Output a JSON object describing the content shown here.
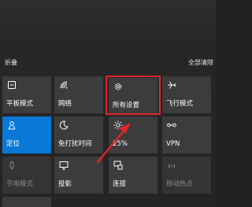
{
  "header": {
    "collapse_label": "折叠",
    "clear_all_label": "全部清除"
  },
  "tiles": [
    {
      "label": "平板模式",
      "icon": "tablet-mode-icon",
      "state": "off"
    },
    {
      "label": "网络",
      "icon": "network-icon",
      "state": "off"
    },
    {
      "label": "所有设置",
      "icon": "settings-gear-icon",
      "state": "off"
    },
    {
      "label": "飞行模式",
      "icon": "airplane-icon",
      "state": "off"
    },
    {
      "label": "定位",
      "icon": "location-icon",
      "state": "on"
    },
    {
      "label": "免打扰时间",
      "icon": "moon-icon",
      "state": "off"
    },
    {
      "label": "25%",
      "icon": "brightness-icon",
      "state": "off"
    },
    {
      "label": "VPN",
      "icon": "vpn-icon",
      "state": "off"
    },
    {
      "label": "节电模式",
      "icon": "battery-saver-icon",
      "state": "disabled"
    },
    {
      "label": "投影",
      "icon": "project-icon",
      "state": "off"
    },
    {
      "label": "连接",
      "icon": "connect-icon",
      "state": "off"
    },
    {
      "label": "移动热点",
      "icon": "hotspot-icon",
      "state": "disabled"
    }
  ],
  "colors": {
    "accent": "#0a78d7",
    "annotation": "#e0252b"
  }
}
